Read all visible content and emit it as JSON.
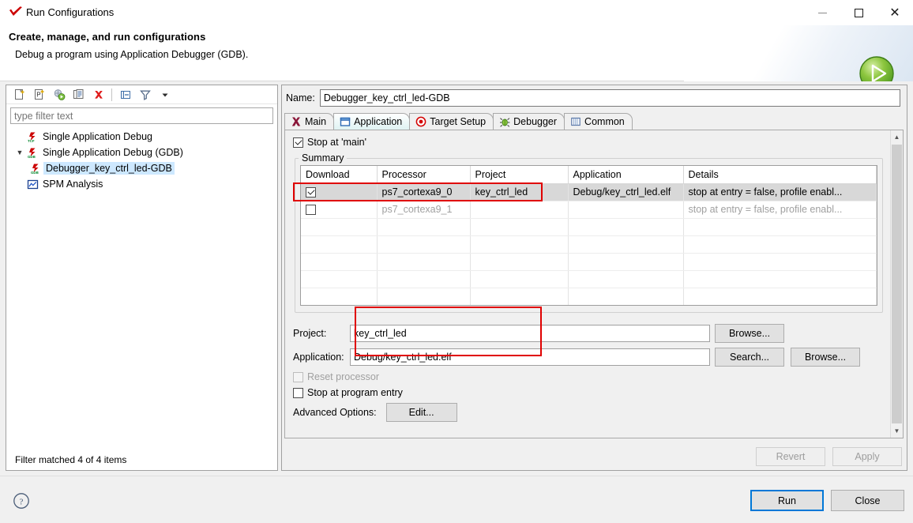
{
  "window": {
    "title": "Run Configurations",
    "app_icon": "xilinx-check-icon",
    "minimize": "minimize-icon",
    "maximize": "maximize-icon",
    "close": "close-icon"
  },
  "header": {
    "title": "Create, manage, and run configurations",
    "subtitle": "Debug a program using Application Debugger (GDB).",
    "badge_icon": "green-run-play-icon"
  },
  "left_panel": {
    "toolbar": [
      {
        "name": "new-launch-configuration-icon",
        "tooltip": "New launch configuration"
      },
      {
        "name": "new-prototype-icon",
        "tooltip": "New prototype"
      },
      {
        "name": "export-icon",
        "tooltip": "Export"
      },
      {
        "name": "duplicate-icon",
        "tooltip": "Duplicate"
      },
      {
        "name": "delete-icon",
        "tooltip": "Delete"
      },
      {
        "name": "collapse-all-icon",
        "tooltip": "Collapse All"
      },
      {
        "name": "filter-icon",
        "tooltip": "Filter launch configurations"
      },
      {
        "name": "view-menu-icon",
        "tooltip": "View Menu"
      }
    ],
    "filter": {
      "value": "",
      "placeholder": "type filter text"
    },
    "tree": [
      {
        "label": "Single Application Debug",
        "icon": "tcf-debug-icon",
        "indent": 0,
        "twisty": "",
        "selected": false
      },
      {
        "label": "Single Application Debug (GDB)",
        "icon": "gdb-debug-icon",
        "indent": 0,
        "twisty": "expanded",
        "selected": false
      },
      {
        "label": "Debugger_key_ctrl_led-GDB",
        "icon": "gdb-debug-icon",
        "indent": 1,
        "twisty": "",
        "selected": true
      },
      {
        "label": "SPM Analysis",
        "icon": "spm-chart-icon",
        "indent": 0,
        "twisty": "",
        "selected": false
      }
    ],
    "status": "Filter matched 4 of 4 items"
  },
  "right_panel": {
    "name_label": "Name:",
    "name_value": "Debugger_key_ctrl_led-GDB",
    "tabs": [
      {
        "label": "Main",
        "icon": "main-x-icon",
        "active": false
      },
      {
        "label": "Application",
        "icon": "application-window-icon",
        "active": true
      },
      {
        "label": "Target Setup",
        "icon": "target-bullseye-icon",
        "active": false
      },
      {
        "label": "Debugger",
        "icon": "debugger-bug-icon",
        "active": false
      },
      {
        "label": "Common",
        "icon": "common-list-icon",
        "active": false
      }
    ],
    "stop_at_main": {
      "label": "Stop at 'main'",
      "checked": true
    },
    "summary": {
      "legend": "Summary",
      "columns": [
        "Download",
        "Processor",
        "Project",
        "Application",
        "Details"
      ],
      "rows": [
        {
          "download": true,
          "processor": "ps7_cortexa9_0",
          "project": "key_ctrl_led",
          "application": "Debug/key_ctrl_led.elf",
          "details": "stop at entry = false, profile enabl...",
          "selected": true,
          "dim": false
        },
        {
          "download": false,
          "processor": "ps7_cortexa9_1",
          "project": "",
          "application": "",
          "details": "stop at entry = false, profile enabl...",
          "selected": false,
          "dim": true
        }
      ],
      "empty_rows": 5
    },
    "project_field": {
      "label": "Project:",
      "value": "key_ctrl_led",
      "browse": "Browse..."
    },
    "application_field": {
      "label": "Application:",
      "value": "Debug/key_ctrl_led.elf",
      "search": "Search...",
      "browse": "Browse..."
    },
    "reset_processor": {
      "label": "Reset processor",
      "checked": false,
      "enabled": false
    },
    "stop_at_program_entry": {
      "label": "Stop at program entry",
      "checked": false,
      "enabled": true
    },
    "advanced_options": {
      "label": "Advanced Options:",
      "button": "Edit..."
    },
    "revert_button": "Revert",
    "apply_button": "Apply",
    "scrollbar": {
      "up": "scroll-up-arrow",
      "down": "scroll-down-arrow"
    }
  },
  "footer": {
    "help_icon": "help-question-icon",
    "run_button": "Run",
    "close_button": "Close"
  },
  "colors": {
    "accent_blue": "#0078d7",
    "highlight_red": "#e00000",
    "selection_blue": "#cde8ff",
    "row_selected_gray": "#d8d8d8"
  }
}
